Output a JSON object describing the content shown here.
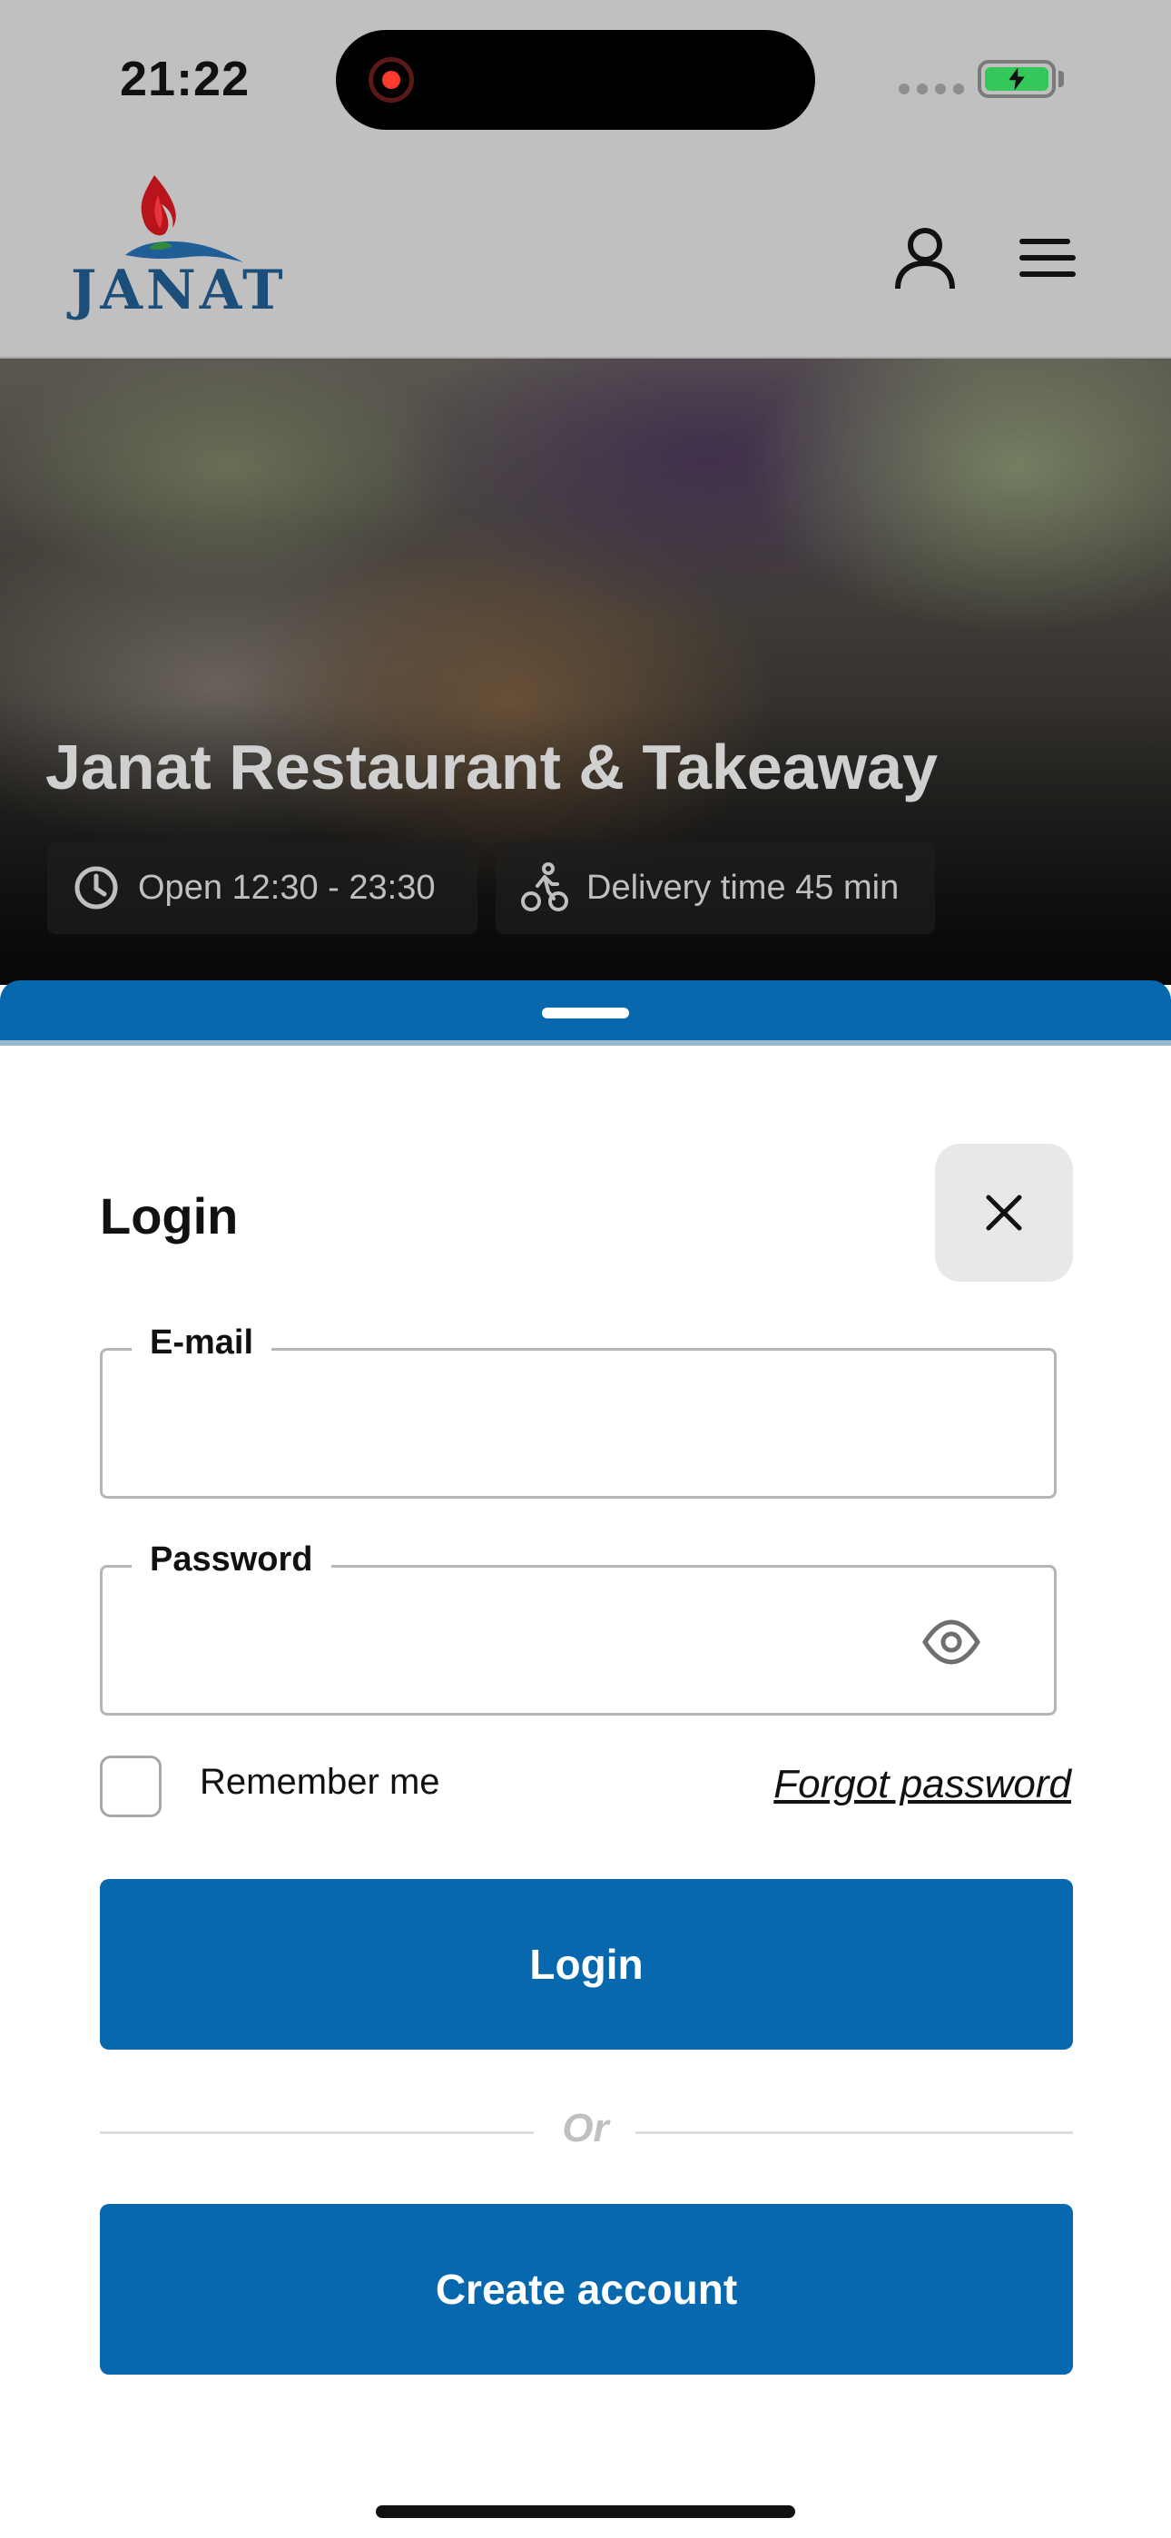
{
  "status_bar": {
    "time": "21:22"
  },
  "header": {
    "logo_text": "JANAT",
    "icons": [
      "user-icon",
      "menu-icon"
    ]
  },
  "hero": {
    "title": "Janat Restaurant & Takeaway",
    "open_hours": "Open 12:30 - 23:30",
    "delivery_time": "Delivery time 45 min",
    "icons": [
      "clock-icon",
      "bicycle-icon"
    ]
  },
  "login_sheet": {
    "title": "Login",
    "email_label": "E-mail",
    "email_value": "",
    "password_label": "Password",
    "password_value": "",
    "remember_label": "Remember me",
    "remember_checked": false,
    "forgot_label": "Forgot password",
    "login_button": "Login",
    "divider_text": "Or",
    "create_button": "Create account"
  },
  "colors": {
    "primary": "#0768ad",
    "overlay_gray": "#c0c0c0",
    "close_button_bg": "#e8e8e8"
  }
}
